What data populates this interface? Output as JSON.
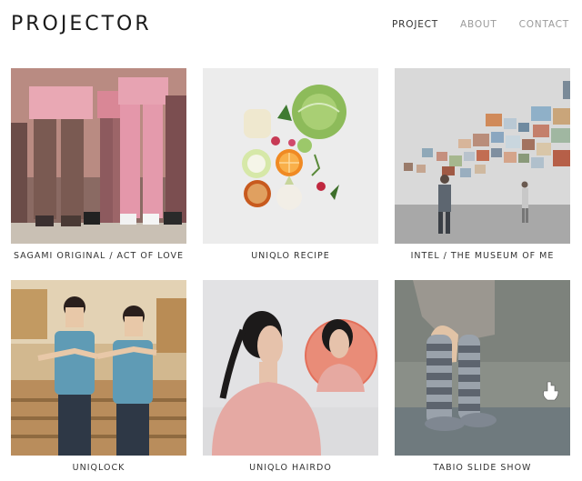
{
  "site": {
    "logo": "PROJECTOR"
  },
  "nav": {
    "items": [
      {
        "label": "PROJECT"
      },
      {
        "label": "ABOUT"
      },
      {
        "label": "CONTACT"
      }
    ]
  },
  "projects": [
    {
      "title": "SAGAMI ORIGINAL / ACT OF LOVE"
    },
    {
      "title": "UNIQLO RECIPE"
    },
    {
      "title": "INTEL / THE MUSEUM OF ME"
    },
    {
      "title": "UNIQLOCK"
    },
    {
      "title": "UNIQLO HAIRDO"
    },
    {
      "title": "TABIO SLIDE SHOW"
    }
  ],
  "colors": {
    "active_nav": "#333333",
    "inactive_nav": "#9a9a9a",
    "caption": "#333333"
  }
}
